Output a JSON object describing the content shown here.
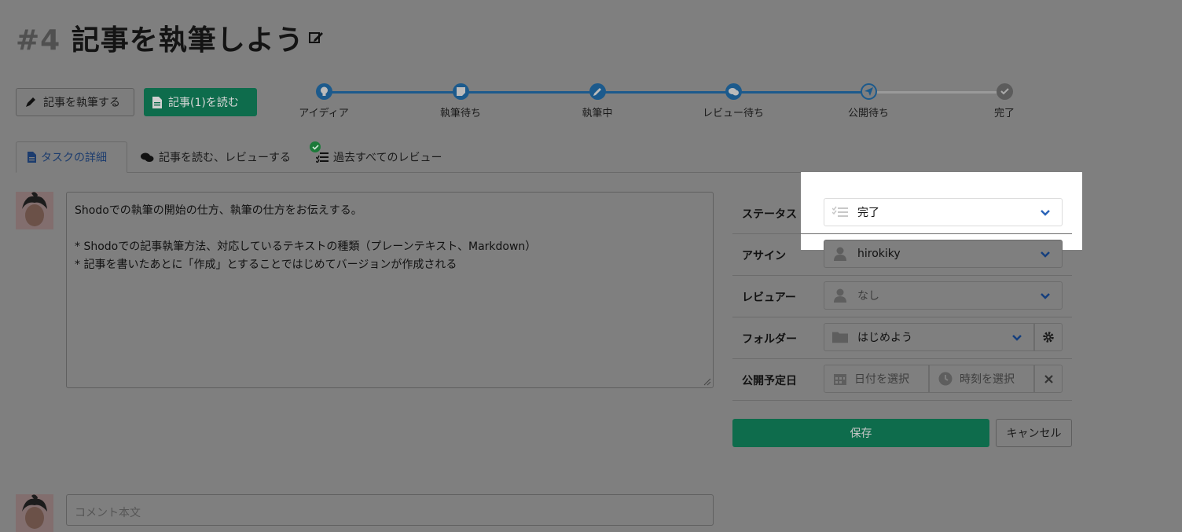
{
  "page": {
    "title_number": "#4",
    "title_text": "記事を執筆しよう"
  },
  "actions": {
    "write_label": "記事を執筆する",
    "read_label": "記事(1)を読む"
  },
  "workflow": {
    "steps": [
      "アイディア",
      "執筆待ち",
      "執筆中",
      "レビュー待ち",
      "公開待ち",
      "完了"
    ],
    "completed_through": 5
  },
  "tabs": {
    "details": "タスクの詳細",
    "read_review": "記事を読む、レビューする",
    "all_reviews": "過去すべてのレビュー"
  },
  "description": {
    "lines": [
      "Shodoでの執筆の開始の仕方、執筆の仕方をお伝えする。",
      "",
      "* Shodoでの記事執筆方法、対応しているテキストの種類（プレーンテキスト、Markdown）",
      "* 記事を書いたあとに「作成」とすることではじめてバージョンが作成される"
    ]
  },
  "comment": {
    "placeholder": "コメント本文"
  },
  "fields": {
    "status": {
      "label": "ステータス",
      "value": "完了"
    },
    "assign": {
      "label": "アサイン",
      "value": "hirokiky"
    },
    "reviewer": {
      "label": "レビュアー",
      "value": "なし"
    },
    "folder": {
      "label": "フォルダー",
      "value": "はじめよう"
    },
    "publish_date": {
      "label": "公開予定日",
      "date_placeholder": "日付を選択",
      "time_placeholder": "時刻を選択"
    }
  },
  "buttons": {
    "save": "保存",
    "cancel": "キャンセル"
  },
  "colors": {
    "accent": "#0e6c4c",
    "step_active": "#1c5a8c",
    "overlay_bg": "#7f7f7f"
  },
  "icons": [
    "edit-icon",
    "pen-icon",
    "file-icon",
    "lightbulb-icon",
    "note-icon",
    "pencil-icon",
    "comments-icon",
    "send-icon",
    "check-icon",
    "tasks-icon",
    "user-icon",
    "folder-icon",
    "gear-icon",
    "calendar-icon",
    "clock-icon",
    "close-icon",
    "chevron-down-icon"
  ]
}
